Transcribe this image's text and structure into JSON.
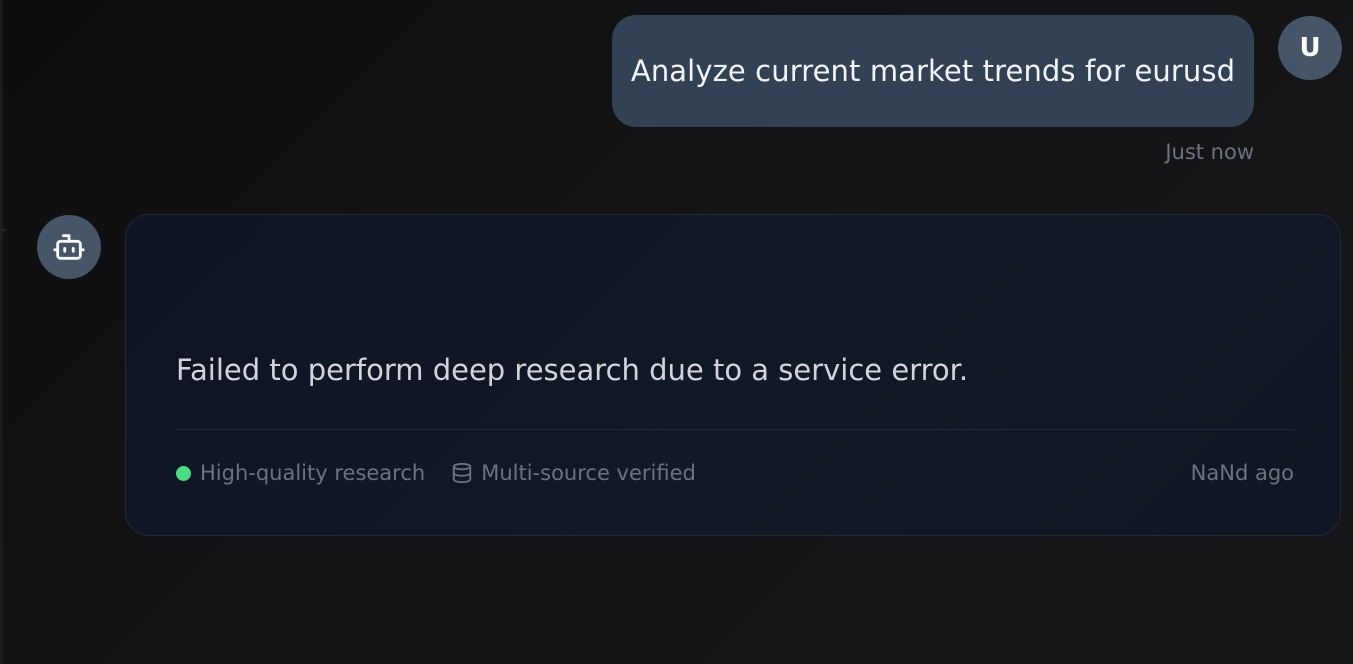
{
  "user_message": {
    "avatar_initial": "U",
    "text": "Analyze current market trends for eurusd",
    "time": "Just now"
  },
  "assistant_message": {
    "avatar_icon": "bot-icon",
    "text": "Failed to perform deep research due to a service error.",
    "badges": {
      "quality": "High-quality research",
      "sources": "Multi-source verified"
    },
    "time": "NaNd ago"
  },
  "colors": {
    "user_bubble": "#334155",
    "avatar_bg": "#475569",
    "status_green": "#4ade80",
    "card_bg": "#111827"
  }
}
